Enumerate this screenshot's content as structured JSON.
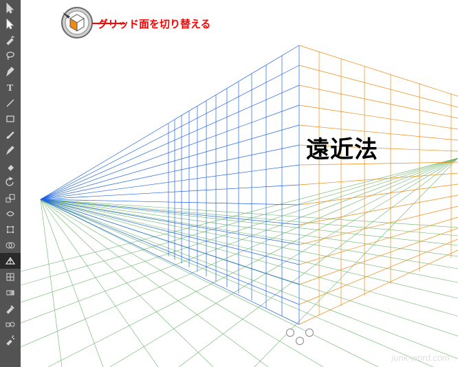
{
  "toolbox": {
    "tools": [
      {
        "name": "selection-tool",
        "selected": false
      },
      {
        "name": "direct-selection-tool",
        "selected": false
      },
      {
        "name": "magic-wand-tool",
        "selected": false
      },
      {
        "name": "lasso-tool",
        "selected": false
      },
      {
        "name": "pen-tool",
        "selected": false
      },
      {
        "name": "type-tool",
        "selected": false
      },
      {
        "name": "line-segment-tool",
        "selected": false
      },
      {
        "name": "rectangle-tool",
        "selected": false
      },
      {
        "name": "paintbrush-tool",
        "selected": false
      },
      {
        "name": "pencil-tool",
        "selected": false
      },
      {
        "name": "eraser-tool",
        "selected": false
      },
      {
        "name": "rotate-tool",
        "selected": false
      },
      {
        "name": "scale-tool",
        "selected": false
      },
      {
        "name": "width-tool",
        "selected": false
      },
      {
        "name": "free-transform-tool",
        "selected": false
      },
      {
        "name": "shape-builder-tool",
        "selected": false
      },
      {
        "name": "perspective-grid-tool",
        "selected": true
      },
      {
        "name": "mesh-tool",
        "selected": false
      },
      {
        "name": "gradient-tool",
        "selected": false
      },
      {
        "name": "eyedropper-tool",
        "selected": false
      },
      {
        "name": "blend-tool",
        "selected": false
      },
      {
        "name": "symbol-sprayer-tool",
        "selected": false
      }
    ]
  },
  "annotation": {
    "label": "グリッド面を切り替える"
  },
  "canvas": {
    "perspective_text": "遠近法"
  },
  "watermark": {
    "text": "junk-word.com"
  },
  "colors": {
    "left_plane": "#1e62e5",
    "right_plane": "#f08a10",
    "floor_plane": "#4ca64c",
    "annotation": "#ff0000"
  }
}
